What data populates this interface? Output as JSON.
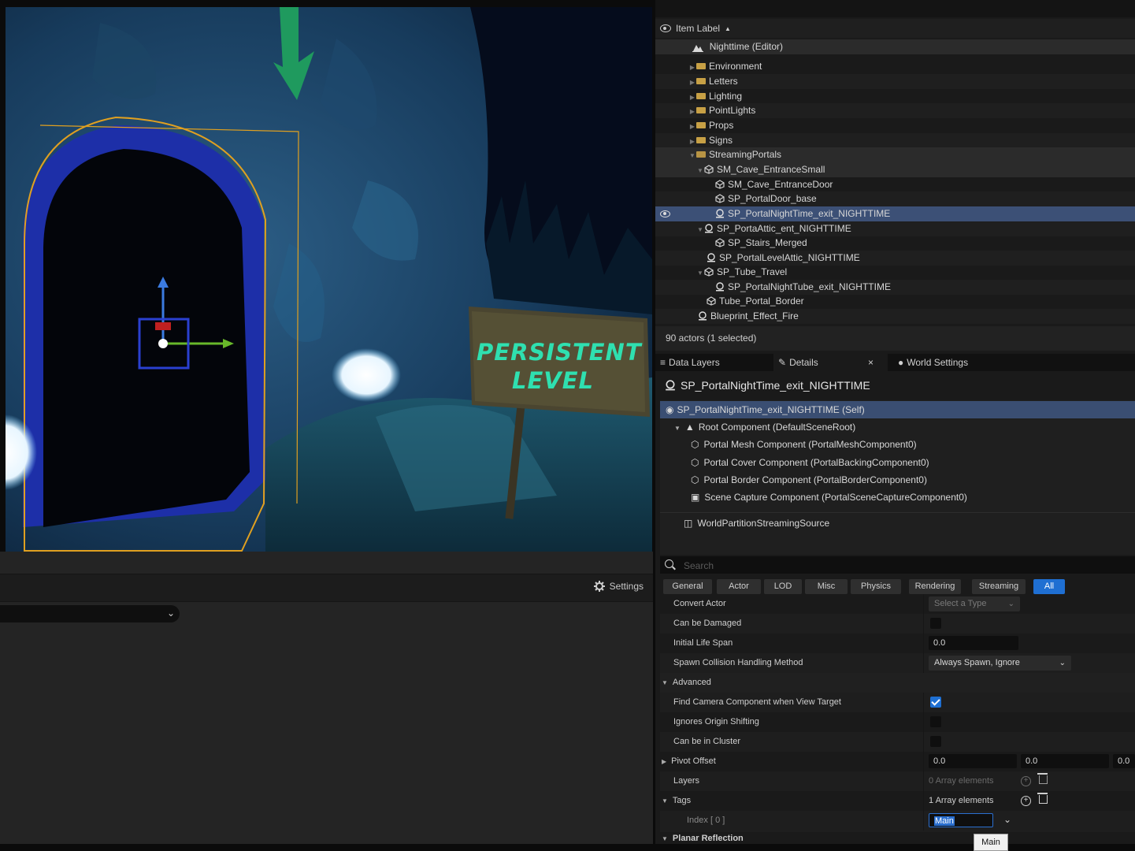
{
  "viewport": {
    "sign_line1": "PERSISTENT",
    "sign_line2": "LEVEL",
    "settings_label": "Settings"
  },
  "outliner": {
    "header_label": "Item Label",
    "sort_indicator": "▲",
    "root_label": "Nighttime (Editor)",
    "rows": [
      {
        "label": "Environment",
        "type": "folder"
      },
      {
        "label": "Letters",
        "type": "folder"
      },
      {
        "label": "Lighting",
        "type": "folder"
      },
      {
        "label": "PointLights",
        "type": "folder"
      },
      {
        "label": "Props",
        "type": "folder"
      },
      {
        "label": "Signs",
        "type": "folder"
      },
      {
        "label": "StreamingPortals",
        "type": "folder"
      },
      {
        "label": "SM_Cave_EntranceSmall",
        "type": "mesh"
      },
      {
        "label": "SM_Cave_EntranceDoor",
        "type": "mesh"
      },
      {
        "label": "SP_PortalDoor_base",
        "type": "mesh"
      },
      {
        "label": "SP_PortalNightTime_exit_NIGHTTIME",
        "type": "actor"
      },
      {
        "label": "SP_PortaAttic_ent_NIGHTTIME",
        "type": "actor"
      },
      {
        "label": "SP_Stairs_Merged",
        "type": "mesh"
      },
      {
        "label": "SP_PortalLevelAttic_NIGHTTIME",
        "type": "actor"
      },
      {
        "label": "SP_Tube_Travel",
        "type": "mesh"
      },
      {
        "label": "SP_PortalNightTube_exit_NIGHTTIME",
        "type": "actor"
      },
      {
        "label": "Tube_Portal_Border",
        "type": "mesh"
      },
      {
        "label": "Blueprint_Effect_Fire",
        "type": "actor"
      }
    ],
    "actor_count": "90 actors (1 selected)"
  },
  "details": {
    "tabs": {
      "data_layers": "Data Layers",
      "details": "Details",
      "close": "×",
      "world_settings": "World Settings"
    },
    "title": "SP_PortalNightTime_exit_NIGHTTIME",
    "components": [
      "SP_PortalNightTime_exit_NIGHTTIME (Self)",
      "Root Component (DefaultSceneRoot)",
      "Portal Mesh Component (PortalMeshComponent0)",
      "Portal Cover Component (PortalBackingComponent0)",
      "Portal Border Component (PortalBorderComponent0)",
      "Scene Capture Component (PortalSceneCaptureComponent0)",
      "WorldPartitionStreamingSource"
    ],
    "search_placeholder": "Search",
    "filters": [
      "General",
      "Actor",
      "LOD",
      "Misc",
      "Physics",
      "Rendering",
      "Streaming",
      "All"
    ],
    "props": {
      "convert_actor": "Convert Actor",
      "select_type": "Select a Type",
      "can_be_damaged": "Can be Damaged",
      "initial_life_span": "Initial Life Span",
      "initial_life_span_value": "0.0",
      "spawn_collision": "Spawn Collision Handling Method",
      "spawn_collision_value": "Always Spawn, Ignore Collisions",
      "advanced": "Advanced",
      "find_camera": "Find Camera Component when View Target",
      "ignores_origin": "Ignores Origin Shifting",
      "can_be_in_cluster": "Can be in Cluster",
      "pivot_offset": "Pivot Offset",
      "pivot_x": "0.0",
      "pivot_y": "0.0",
      "pivot_z": "0.0",
      "layers": "Layers",
      "layers_count": "0 Array elements",
      "tags": "Tags",
      "tags_count": "1 Array elements",
      "index0": "Index [ 0 ]",
      "index0_value": "Main",
      "planar_reflection": "Planar Reflection",
      "tooltip": "Main"
    }
  }
}
